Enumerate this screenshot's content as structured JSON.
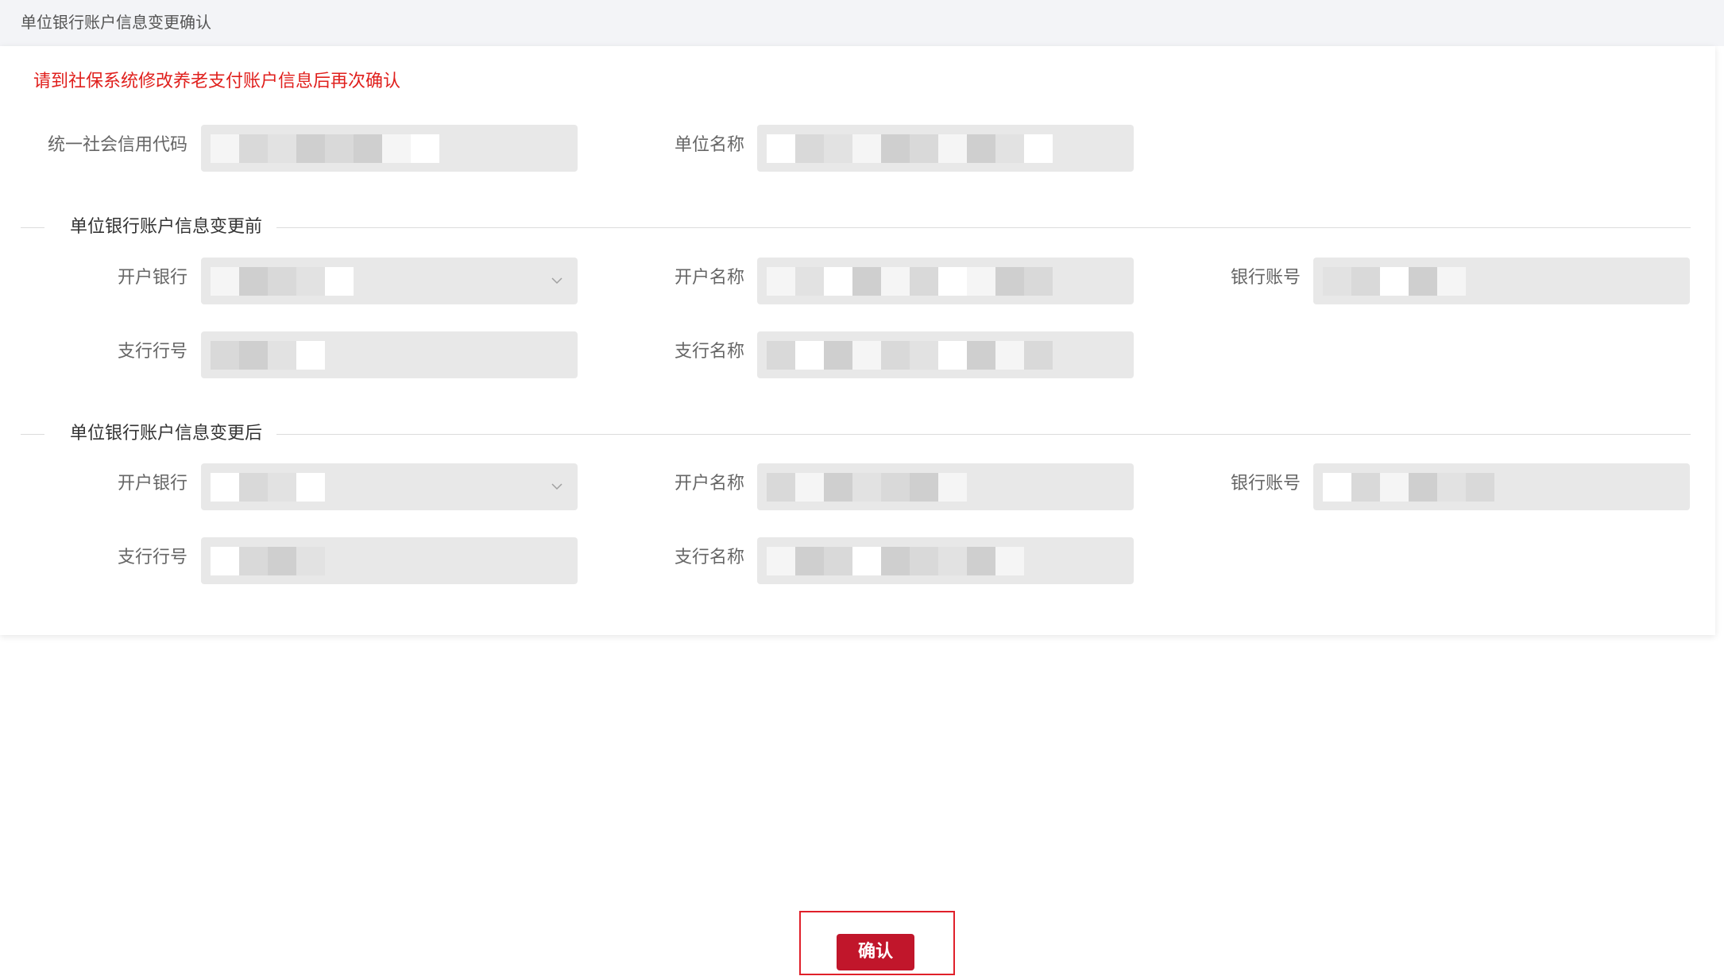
{
  "page": {
    "title": "单位银行账户信息变更确认"
  },
  "notice": "请到社保系统修改养老支付账户信息后再次确认",
  "company": {
    "credit_code_label": "统一社会信用代码",
    "credit_code_value": "",
    "name_label": "单位名称",
    "name_value": ""
  },
  "before": {
    "section_title": "单位银行账户信息变更前",
    "bank_label": "开户银行",
    "bank_value": "",
    "account_name_label": "开户名称",
    "account_name_value": "",
    "account_no_label": "银行账号",
    "account_no_value": "",
    "branch_no_label": "支行行号",
    "branch_no_value": "",
    "branch_name_label": "支行名称",
    "branch_name_value": ""
  },
  "after": {
    "section_title": "单位银行账户信息变更后",
    "bank_label": "开户银行",
    "bank_value": "",
    "account_name_label": "开户名称",
    "account_name_value": "",
    "account_no_label": "银行账号",
    "account_no_value": "",
    "branch_no_label": "支行行号",
    "branch_no_value": "",
    "branch_name_label": "支行名称",
    "branch_name_value": ""
  },
  "actions": {
    "confirm_label": "确认"
  },
  "colors": {
    "notice": "#e0201d",
    "primary_button": "#c1162b",
    "highlight_border": "#e0202a",
    "field_bg": "#e8e8e8"
  },
  "icons": {
    "select_arrow": "chevron-down-icon"
  }
}
